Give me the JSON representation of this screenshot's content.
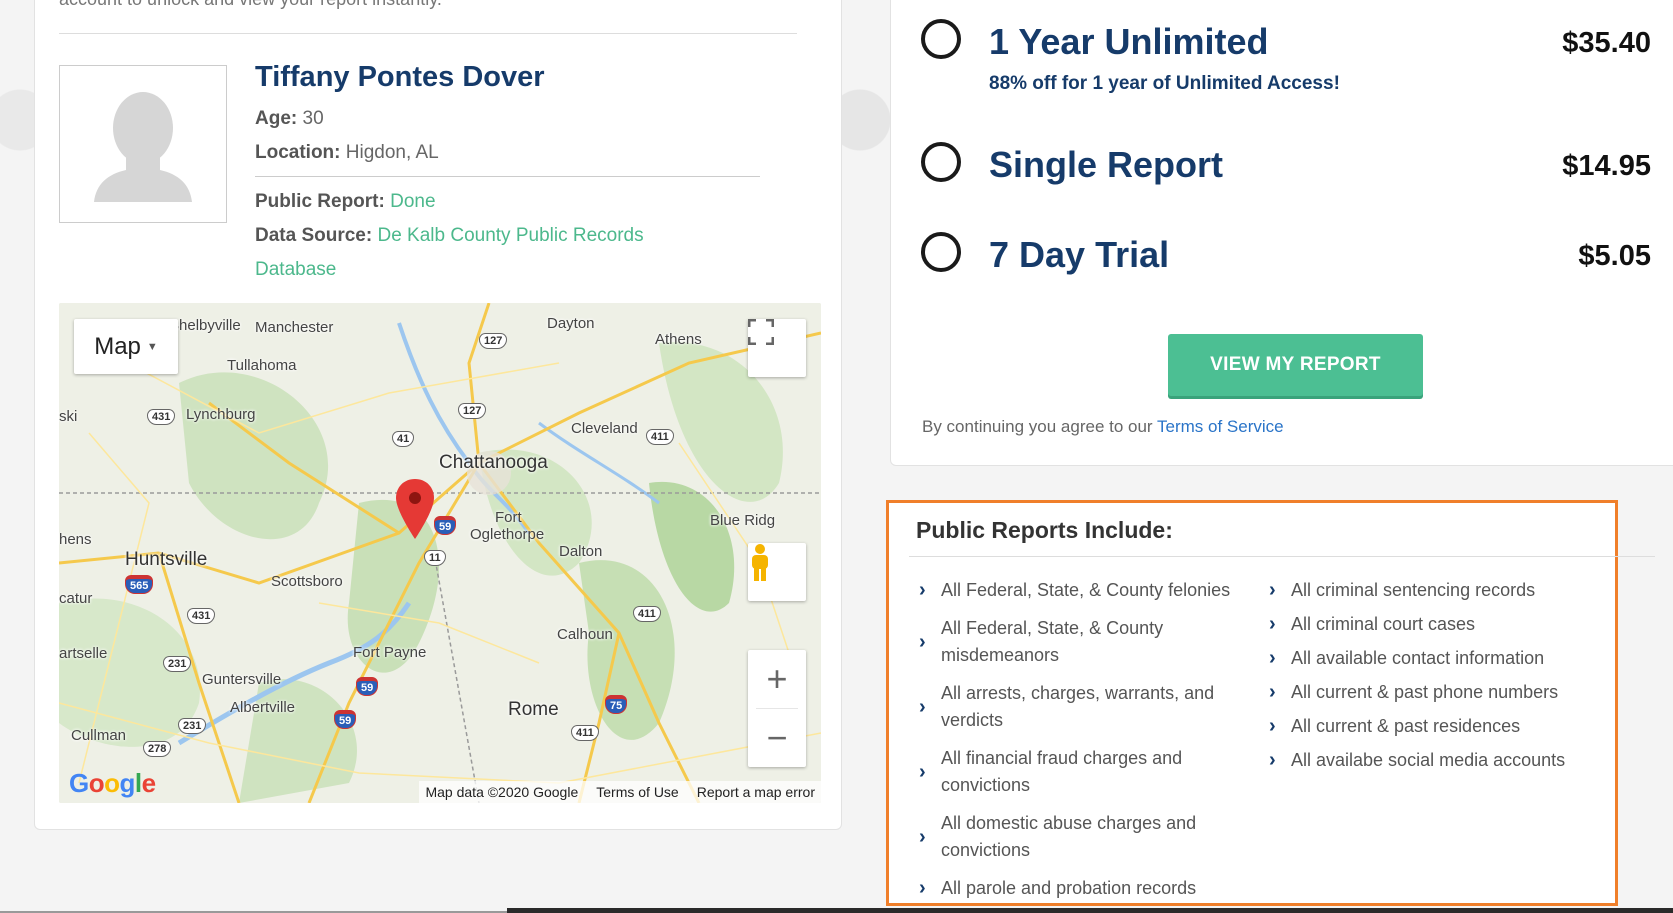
{
  "intro": "account to unlock and view your report instantly.",
  "profile": {
    "name": "Tiffany Pontes Dover",
    "age_label": "Age:",
    "age": "30",
    "location_label": "Location:",
    "location": "Higdon, AL",
    "public_report_label": "Public Report:",
    "public_report": "Done",
    "data_source_label": "Data Source:",
    "data_source_line1": "De Kalb County Public Records",
    "data_source_line2": "Database",
    "avatar_icon": "person-silhouette-icon"
  },
  "map": {
    "type_button": "Map",
    "fullscreen_icon": "fullscreen-icon",
    "pegman_icon": "pegman-icon",
    "zoom_in": "+",
    "zoom_out": "−",
    "footer": {
      "data": "Map data ©2020 Google",
      "terms": "Terms of Use",
      "report": "Report a map error"
    },
    "logo": "Google",
    "places": {
      "shelbyville": "Shelbyville",
      "manchester": "Manchester",
      "dayton": "Dayton",
      "athens": "Athens",
      "tullahoma": "Tullahoma",
      "lynchburg": "Lynchburg",
      "pulaski": "ski",
      "cleveland": "Cleveland",
      "chattanooga": "Chattanooga",
      "huntsville": "Huntsville",
      "athens_al": "hens",
      "fort_oglethorpe_1": "Fort",
      "fort_oglethorpe_2": "Oglethorpe",
      "blue_ridge": "Blue Ridg",
      "dalton": "Dalton",
      "scottsboro": "Scottsboro",
      "decatur": "catur",
      "calhoun": "Calhoun",
      "hartselle": "artselle",
      "fort_payne": "Fort Payne",
      "guntersville": "Guntersville",
      "albertville": "Albertville",
      "rome": "Rome",
      "cullman": "Cullman"
    },
    "highways": {
      "h127a": "127",
      "h127b": "127",
      "h431a": "431",
      "h41": "41",
      "h411a": "411",
      "h59a": "59",
      "h11": "11",
      "h565": "565",
      "h431b": "431",
      "h411b": "411",
      "h231a": "231",
      "h59b": "59",
      "h75": "75",
      "h59c": "59",
      "h231b": "231",
      "h411c": "411",
      "h278": "278"
    }
  },
  "plans": [
    {
      "name": "1 Year Unlimited",
      "sub": "88% off for 1 year of Unlimited Access!",
      "price": "$35.40"
    },
    {
      "name": "Single Report",
      "sub": "",
      "price": "$14.95"
    },
    {
      "name": "7 Day Trial",
      "sub": "",
      "price": "$5.05"
    }
  ],
  "cta": "VIEW MY REPORT",
  "tos": {
    "text": "By continuing you agree to our ",
    "link": "Terms of Service"
  },
  "reports": {
    "title": "Public Reports Include:",
    "col1": [
      "All Federal, State, & County felonies",
      "All Federal, State, & County misdemeanors",
      "All arrests, charges, warrants, and verdicts",
      "All financial fraud charges and convictions",
      "All domestic abuse charges and convictions",
      "All parole and probation records"
    ],
    "col2": [
      "All criminal sentencing records",
      "All criminal court cases",
      "All available contact information",
      "All current & past phone numbers",
      "All current & past residences",
      "All availabe social media accounts"
    ]
  },
  "colors": {
    "navy": "#163b6a",
    "green": "#4cbf93",
    "orange_border": "#f07f2a",
    "link_blue": "#2a74c8"
  }
}
